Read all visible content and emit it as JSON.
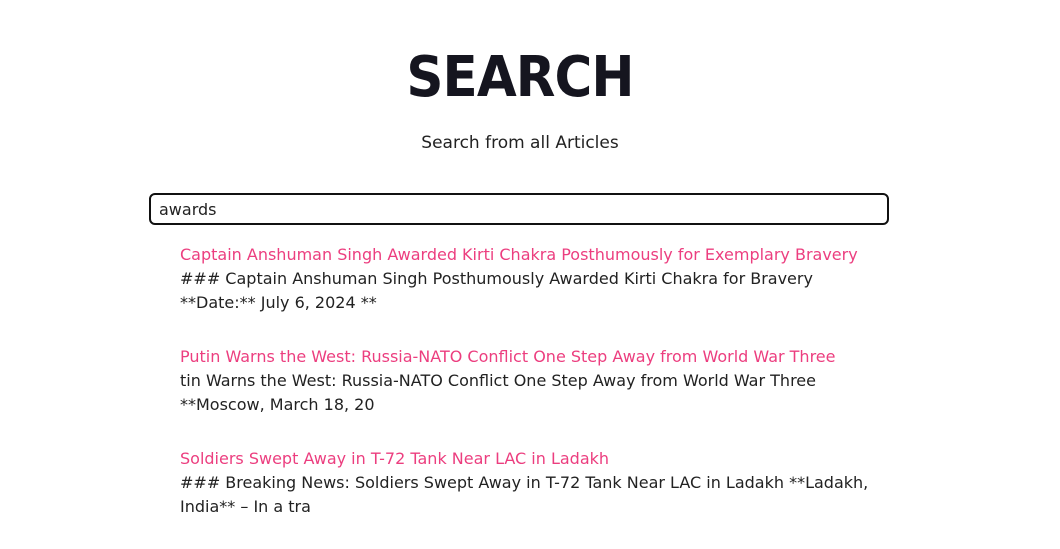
{
  "header": {
    "title": "SEARCH",
    "subtitle": "Search from all Articles"
  },
  "search": {
    "value": "awards"
  },
  "results": [
    {
      "title": "Captain Anshuman Singh Awarded Kirti Chakra Posthumously for Exemplary Bravery",
      "snippet": "### Captain Anshuman Singh Posthumously Awarded Kirti Chakra for Bravery **Date:** July 6, 2024 **"
    },
    {
      "title": "Putin Warns the West: Russia-NATO Conflict One Step Away from World War Three",
      "snippet": "tin Warns the West: Russia-NATO Conflict One Step Away from World War Three **Moscow, March 18, 20"
    },
    {
      "title": "Soldiers Swept Away in T-72 Tank Near LAC in Ladakh",
      "snippet": "### Breaking News: Soldiers Swept Away in T-72 Tank Near LAC in Ladakh **Ladakh, India** – In a tra"
    }
  ],
  "colors": {
    "result_title": "#ec3e7f",
    "text": "#222222",
    "heading": "#15151f"
  }
}
